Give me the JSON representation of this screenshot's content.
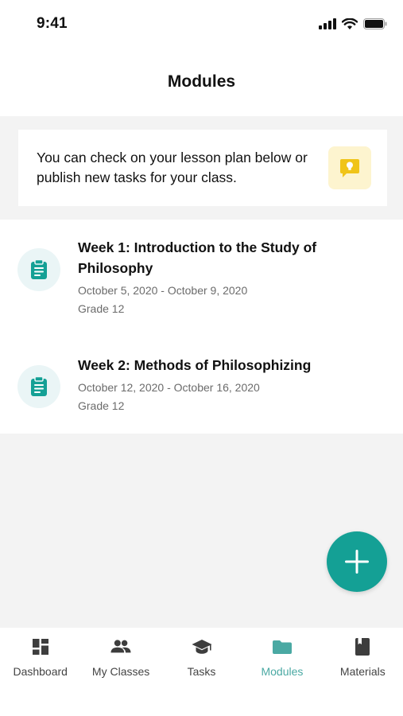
{
  "status_bar": {
    "time": "9:41"
  },
  "header": {
    "title": "Modules"
  },
  "info_card": {
    "text": "You can check on your lesson plan below or publish new tasks for your class.",
    "icon": "lightbulb-bubble-icon"
  },
  "modules": [
    {
      "title": "Week 1: Introduction to the Study of Philosophy",
      "dates": "October 5, 2020 - October 9, 2020",
      "grade": "Grade 12",
      "icon": "clipboard-icon"
    },
    {
      "title": "Week 2: Methods of Philosophizing",
      "dates": "October 12, 2020 - October 16, 2020",
      "grade": "Grade 12",
      "icon": "clipboard-icon"
    }
  ],
  "fab": {
    "icon": "plus-icon"
  },
  "tabs": [
    {
      "label": "Dashboard",
      "icon": "dashboard-icon"
    },
    {
      "label": "My Classes",
      "icon": "people-icon"
    },
    {
      "label": "Tasks",
      "icon": "graduation-cap-icon"
    },
    {
      "label": "Modules",
      "icon": "folder-icon",
      "active": true
    },
    {
      "label": "Materials",
      "icon": "book-icon"
    }
  ],
  "colors": {
    "accent": "#14a095",
    "active_tab": "#4aa9a3",
    "icon_dark": "#3d3d3d",
    "bulb_bg": "#fdf4cf",
    "bulb": "#f0c419"
  }
}
